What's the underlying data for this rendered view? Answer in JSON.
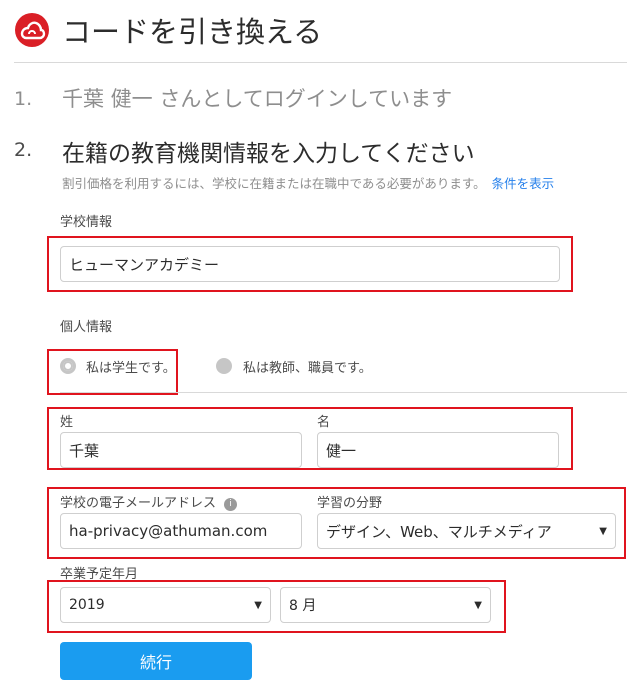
{
  "header": {
    "logo_icon": "creative-cloud-logo-icon",
    "title": "コードを引き換える"
  },
  "step1": {
    "number": "1.",
    "text": "千葉 健一 さんとしてログインしています"
  },
  "step2": {
    "number": "2.",
    "text": "在籍の教育機関情報を入力してください",
    "description": "割引価格を利用するには、学校に在籍または在職中である必要があります。",
    "terms_link": "条件を表示"
  },
  "school": {
    "label": "学校情報",
    "value": "ヒューマンアカデミー"
  },
  "personal": {
    "label": "個人情報",
    "options": [
      {
        "label": "私は学生です。",
        "selected": true
      },
      {
        "label": "私は教師、職員です。",
        "selected": false
      }
    ]
  },
  "name": {
    "last_label": "姓",
    "last_value": "千葉",
    "first_label": "名",
    "first_value": "健一"
  },
  "email": {
    "label": "学校の電子メールアドレス",
    "info_icon": "i",
    "value": "ha-privacy@athuman.com"
  },
  "field_of_study": {
    "label": "学習の分野",
    "value": "デザイン、Web、マルチメディア"
  },
  "graduation": {
    "label": "卒業予定年月",
    "year": "2019",
    "month": "8 月"
  },
  "continue_button": "続行",
  "colors": {
    "highlight": "#e0141e",
    "button": "#1a9cf0",
    "link": "#2680eb",
    "logo": "#da1f26"
  }
}
